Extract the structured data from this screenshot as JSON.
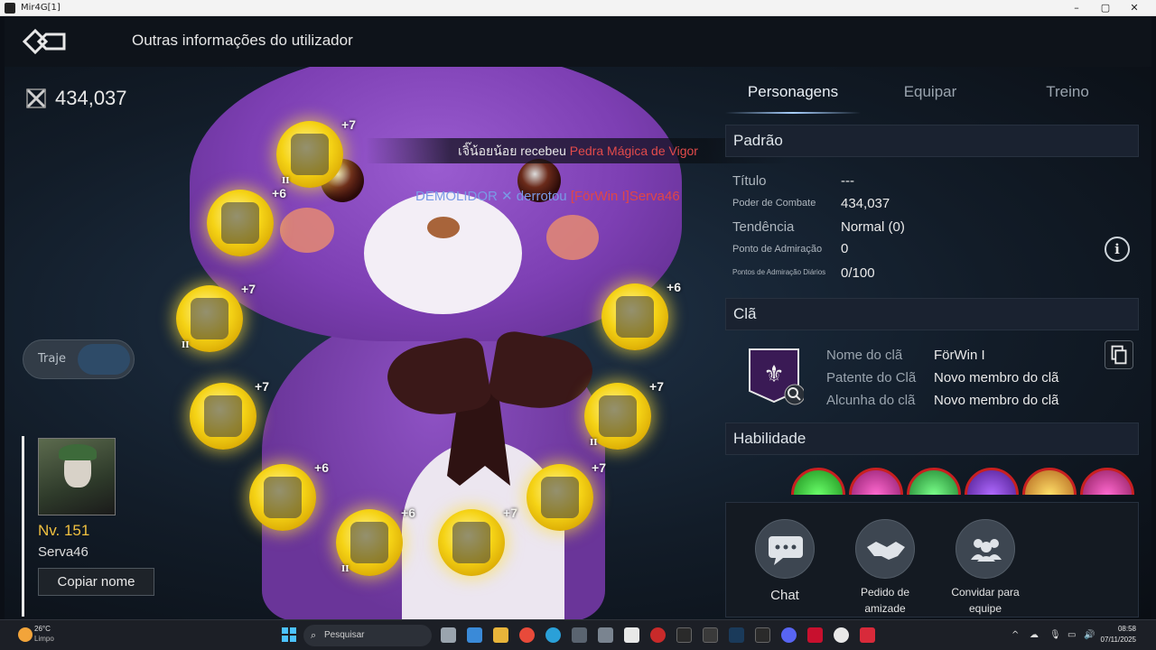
{
  "window": {
    "title": "Mir4G[1]",
    "controls": [
      "–",
      "▢",
      "✕"
    ]
  },
  "header": {
    "title": "Outras informações do utilizador"
  },
  "combat_power": "434,037",
  "traje": {
    "label": "Traje"
  },
  "player": {
    "level": "Nv. 151",
    "name": "Serva46",
    "copy_label": "Copiar nome"
  },
  "equipment": [
    {
      "name": "weapon",
      "plus": "+7",
      "tier": "II"
    },
    {
      "name": "secondary",
      "plus": "+6",
      "tier": ""
    },
    {
      "name": "armor",
      "plus": "+7",
      "tier": "II"
    },
    {
      "name": "pants",
      "plus": "+7",
      "tier": ""
    },
    {
      "name": "gloves",
      "plus": "+6",
      "tier": ""
    },
    {
      "name": "boots",
      "plus": "+6",
      "tier": "II"
    },
    {
      "name": "necklace",
      "plus": "+7",
      "tier": ""
    },
    {
      "name": "earrings",
      "plus": "+6",
      "tier": ""
    },
    {
      "name": "ring",
      "plus": "+7",
      "tier": "II"
    },
    {
      "name": "bracelet",
      "plus": "+7",
      "tier": ""
    }
  ],
  "system_message": {
    "player": "เจิ๊น้อยน้อย",
    "verb": "recebeu",
    "item": "Pedra Mágica de Vigor"
  },
  "kill_message": {
    "killer": "DEMOLIDOR",
    "verb": "derrotou",
    "victim": "[FörWin I]Serva46"
  },
  "tabs": [
    {
      "label": "Personagens",
      "active": true
    },
    {
      "label": "Equipar",
      "active": false
    },
    {
      "label": "Treino",
      "active": false
    }
  ],
  "padrao": {
    "header": "Padrão",
    "titulo_label": "Título",
    "titulo_value": "---",
    "poder_label": "Poder de Combate",
    "poder_value": "434,037",
    "tendencia_label": "Tendência",
    "tendencia_value": "Normal (0)",
    "admiracao_label": "Ponto de Admiração",
    "admiracao_value": "0",
    "diarios_label": "Pontos de Admiração Diários",
    "diarios_value": "0/100"
  },
  "cla": {
    "header": "Clã",
    "nome_label": "Nome do clã",
    "nome_value": "FörWin I",
    "patente_label": "Patente do Clã",
    "patente_value": "Novo membro do clã",
    "alcunha_label": "Alcunha do clã",
    "alcunha_value": "Novo membro do clã"
  },
  "habilidade": {
    "header": "Habilidade"
  },
  "actions": {
    "chat": "Chat",
    "friend_1": "Pedido de",
    "friend_2": "amizade",
    "party_1": "Convidar para",
    "party_2": "equipe"
  },
  "taskbar": {
    "weather_temp": "26°C",
    "weather_cond": "Limpo",
    "search_placeholder": "Pesquisar",
    "time": "08:58",
    "date": "07/11/2025"
  },
  "colors": {
    "gold": "#f5d316",
    "accent_red": "#e24b4b",
    "panel": "#1a2230"
  }
}
